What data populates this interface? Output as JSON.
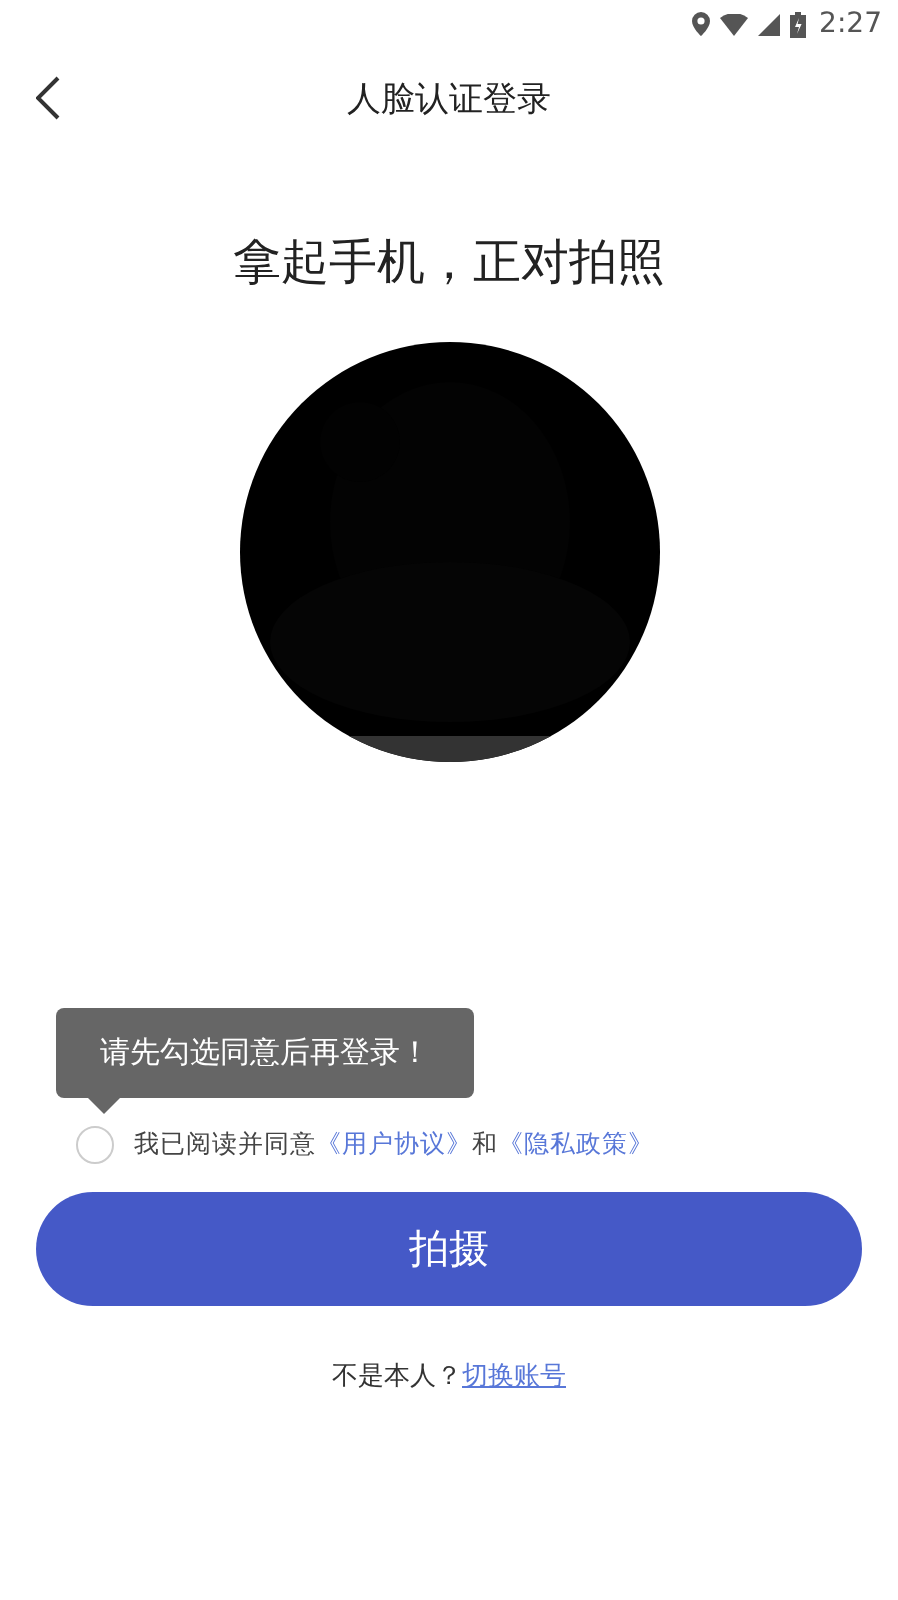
{
  "status_bar": {
    "time": "2:27"
  },
  "header": {
    "title": "人脸认证登录"
  },
  "prompt": "拿起手机，正对拍照",
  "tooltip": "请先勾选同意后再登录！",
  "agreement": {
    "checked": false,
    "text": "我已阅读并同意",
    "links": [
      "《用户协议》",
      "《隐私政策》"
    ],
    "joiner": "和"
  },
  "capture_button": "拍摄",
  "switch": {
    "question": "不是本人？",
    "link": "切换账号"
  }
}
